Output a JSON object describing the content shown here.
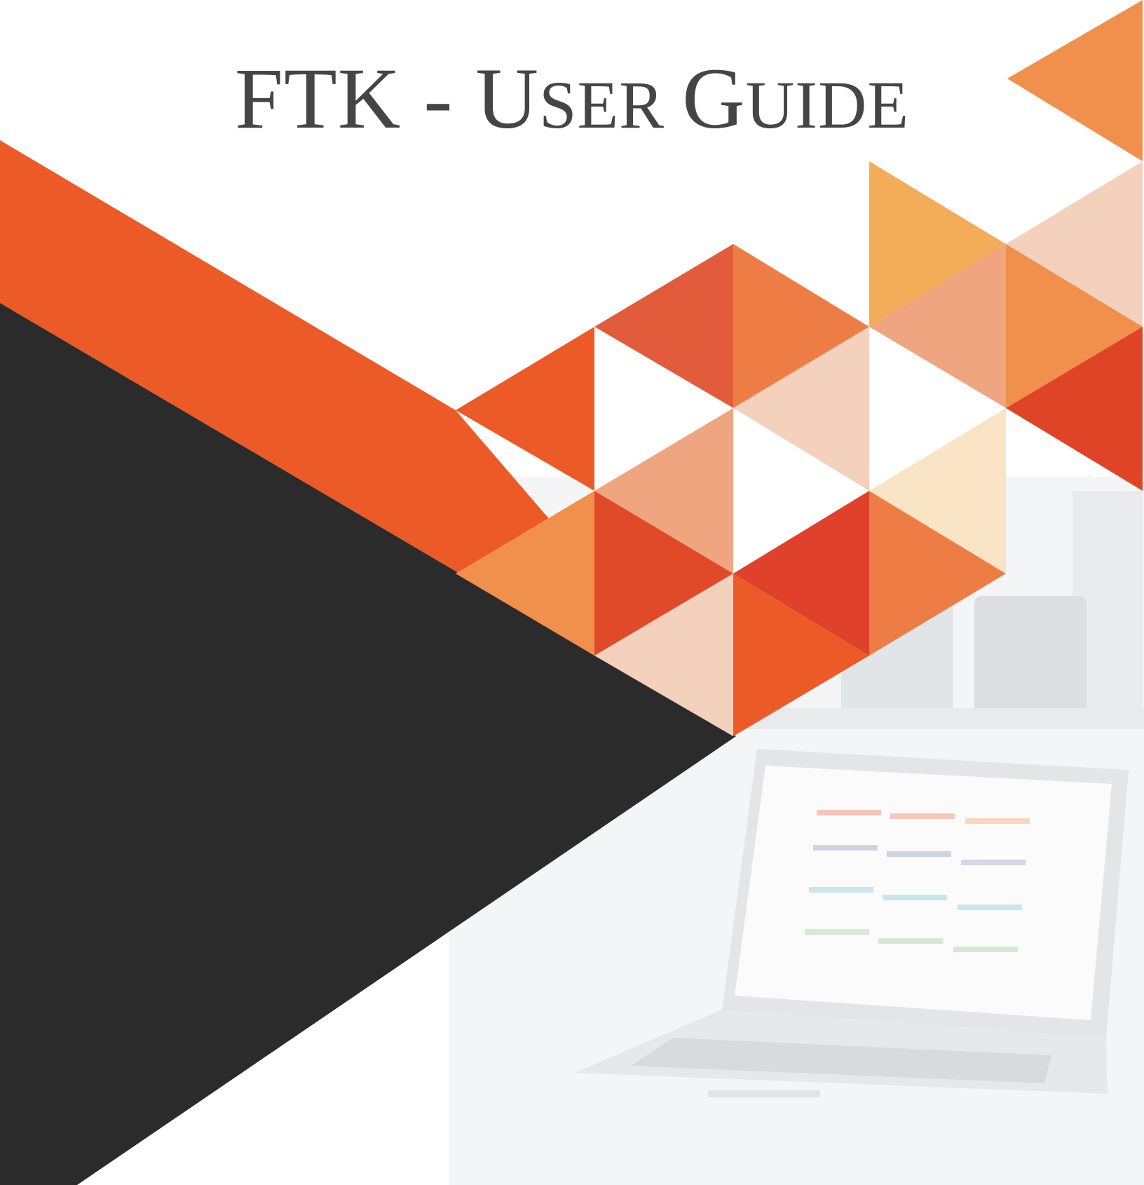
{
  "cover": {
    "title_parts": {
      "p1": "FTK - ",
      "p2": "U",
      "p3": "SER ",
      "p4": "G",
      "p5": "UIDE"
    }
  },
  "palette": {
    "dark": "#2c2b2b",
    "orange_main": "#ec5a27",
    "orange_light": "#f0904c",
    "peach": "#f4d1bd",
    "salmon": "#efa57f",
    "red": "#e0412a",
    "gold": "#f3ad58",
    "cream": "#f9e4c6"
  },
  "icons": {
    "background": "laptop-office-photo-icon"
  }
}
